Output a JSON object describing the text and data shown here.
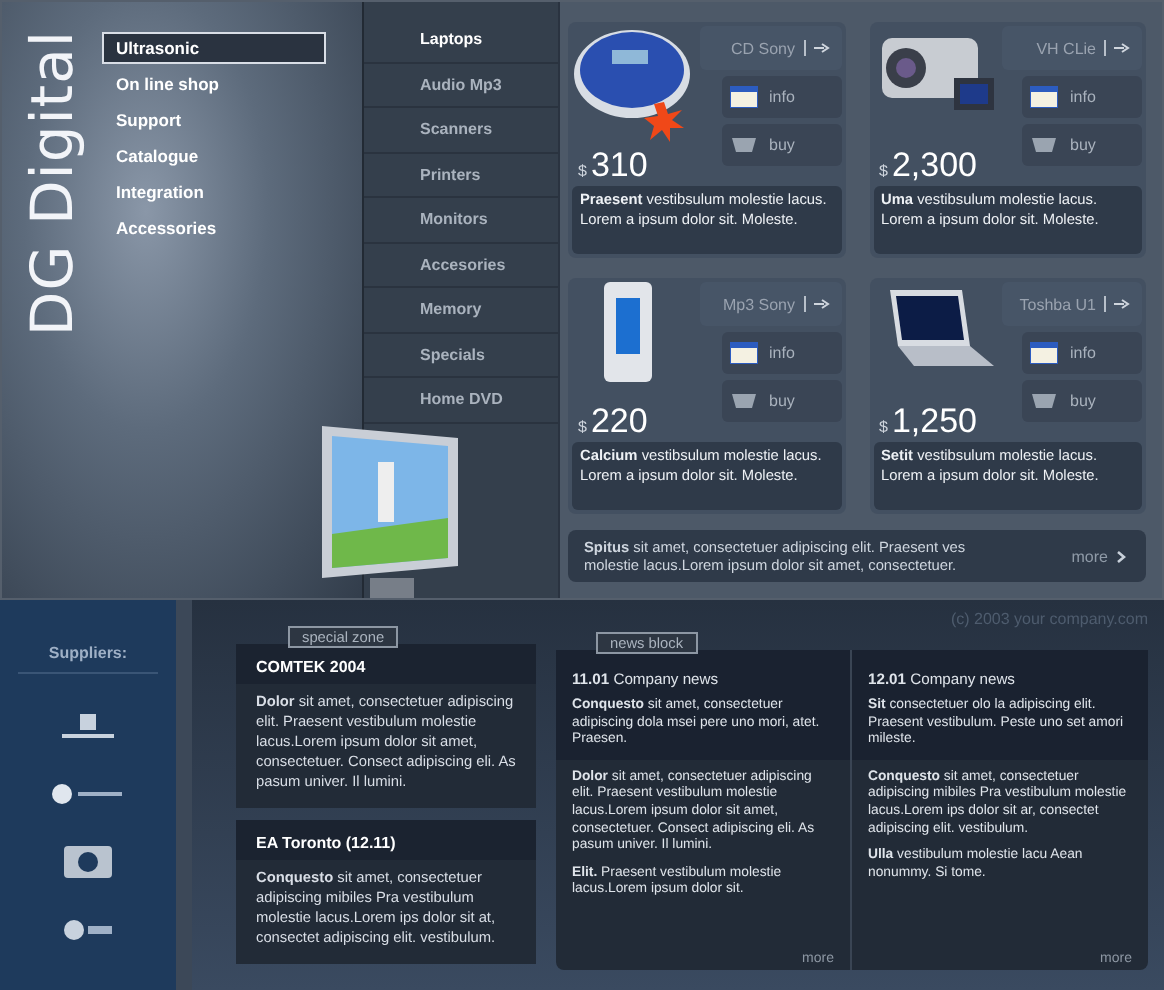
{
  "brand": {
    "name": "DG Digital"
  },
  "main_nav": [
    {
      "label": "Ultrasonic",
      "selected": true
    },
    {
      "label": "On line shop",
      "selected": false
    },
    {
      "label": "Support",
      "selected": false
    },
    {
      "label": "Catalogue",
      "selected": false
    },
    {
      "label": "Integration",
      "selected": false
    },
    {
      "label": "Accessories",
      "selected": false
    }
  ],
  "categories": [
    {
      "label": "Laptops",
      "selected": true
    },
    {
      "label": "Audio Mp3",
      "selected": false
    },
    {
      "label": "Scanners",
      "selected": false
    },
    {
      "label": "Printers",
      "selected": false
    },
    {
      "label": "Monitors",
      "selected": false
    },
    {
      "label": "Accesories",
      "selected": false
    },
    {
      "label": "Memory",
      "selected": false
    },
    {
      "label": "Specials",
      "selected": false
    },
    {
      "label": "Home DVD",
      "selected": false
    }
  ],
  "products": [
    {
      "kind": "cd-player",
      "name": "CD Sony",
      "sale_badge": true,
      "info": "info",
      "buy": "buy",
      "currency": "$",
      "price": "310",
      "description": "**Praesent** vestibsulum molestie lacus. Lorem a  ipsum dolor sit. Moleste."
    },
    {
      "kind": "camcorder",
      "name": "VH CLie",
      "sale_badge": false,
      "info": "info",
      "buy": "buy",
      "currency": "$",
      "price": "2,300",
      "description": "**Uma** vestibsulum molestie lacus. Lorem a  ipsum dolor sit. Moleste."
    },
    {
      "kind": "mp3-player",
      "name": "Mp3 Sony",
      "sale_badge": false,
      "info": "info",
      "buy": "buy",
      "currency": "$",
      "price": "220",
      "description": "**Calcium** vestibsulum molestie lacus. Lorem a  ipsum dolor sit. Moleste."
    },
    {
      "kind": "laptop",
      "name": "Toshba U1",
      "sale_badge": false,
      "info": "info",
      "buy": "buy",
      "currency": "$",
      "price": "1,250",
      "description": "**Setit** vestibsulum molestie lacus. Lorem a  ipsum dolor sit. Moleste."
    }
  ],
  "promo": {
    "text": "**Spitus** sit amet, consectetuer adipiscing elit. Praesent ves molestie lacus.Lorem ipsum dolor sit amet, consectetuer.",
    "more": "more"
  },
  "copyright": "(c) 2003 your company.com",
  "suppliers": {
    "title": "Suppliers:"
  },
  "special_zone": {
    "label": "special zone",
    "items": [
      {
        "title": "COMTEK 2004",
        "text": "**Dolor** sit amet, consectetuer adipiscing elit. Praesent vestibulum molestie lacus.Lorem ipsum dolor sit amet, consectetuer. Consect adipiscing eli. As pasum univer. Il lumini."
      },
      {
        "title": "EA Toronto (12.11)",
        "text": "**Conquesto** sit amet, consectetuer adipiscing mibiles  Pra vestibulum molestie lacus.Lorem ips dolor sit at, consectet adipiscing elit. vestibulum."
      }
    ]
  },
  "news_block": {
    "label": "news block",
    "columns": [
      {
        "date": "11.01",
        "heading": "Company news",
        "lead": "**Conquesto** sit amet, consectetuer adipiscing dola msei pere uno mori, atet. Praesen.",
        "items": [
          "**Dolor** sit amet, consectetuer adipiscing elit. Praesent vestibulum molestie lacus.Lorem ipsum dolor sit amet, consectetuer. Consect adipiscing eli. As pasum univer. Il lumini.",
          "**Elit.** Praesent vestibulum molestie lacus.Lorem ipsum dolor sit."
        ],
        "more": "more"
      },
      {
        "date": "12.01",
        "heading": "Company news",
        "lead": "**Sit** consectetuer olo la adipiscing elit. Praesent vestibulum. Peste uno set amori mileste.",
        "items": [
          "**Conquesto** sit amet, consectetuer adipiscing mibiles  Pra vestibulum molestie lacus.Lorem ips dolor sit ar, consectet adipiscing elit. vestibulum.",
          "**Ulla** vestibulum molestie lacu Aean nonummy. Si tome."
        ],
        "more": "more"
      }
    ]
  }
}
